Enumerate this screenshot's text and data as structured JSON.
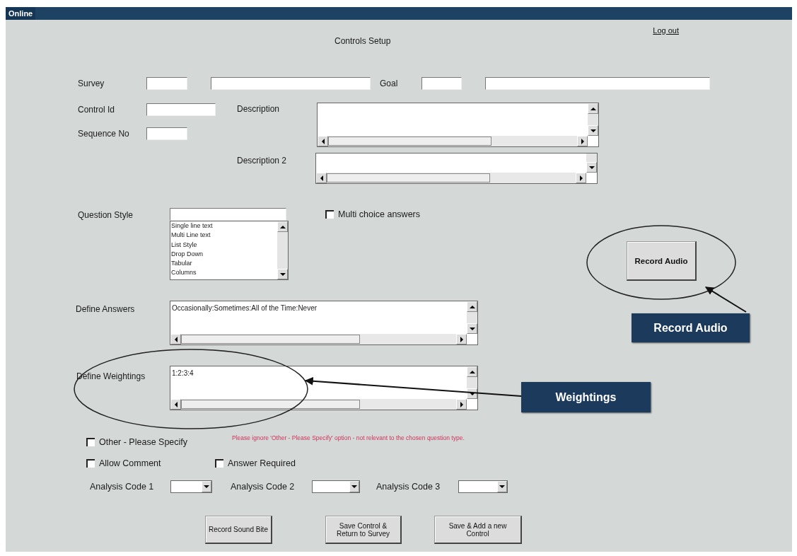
{
  "window": {
    "title": "Online"
  },
  "header": {
    "title": "Controls Setup",
    "logout": "Log out"
  },
  "survey": {
    "label": "Survey",
    "goal_label": "Goal"
  },
  "control_id": {
    "label": "Control Id"
  },
  "description": {
    "label": "Description"
  },
  "sequence_no": {
    "label": "Sequence No"
  },
  "description_2": {
    "label": "Description 2"
  },
  "question_style": {
    "label": "Question Style",
    "options": [
      "Single line text",
      "Multi Line text",
      "List Style",
      "Drop Down",
      "Tabular",
      "Columns"
    ]
  },
  "multi_choice": {
    "label": "Multi choice answers",
    "checked": false
  },
  "record_audio_button": "Record Audio",
  "define_answers": {
    "label": "Define Answers",
    "value": "Occasionally:Sometimes:All of the Time:Never"
  },
  "define_weightings": {
    "label": "Define Weightings",
    "value": "1:2:3:4"
  },
  "options": [
    {
      "label": "Other - Please Specify",
      "checked": false
    },
    {
      "label": "Allow Comment",
      "checked": false
    },
    {
      "label": "Answer Required",
      "checked": false
    }
  ],
  "note": "Please ignore 'Other - Please Specify' option - not relevant to the chosen question type.",
  "analysis_codes": [
    {
      "label": "Analysis Code 1"
    },
    {
      "label": "Analysis Code 2"
    },
    {
      "label": "Analysis Code 3"
    }
  ],
  "buttons": [
    "Record Sound Bite",
    "Save Control & Return to Survey",
    "Save & Add a new Control"
  ],
  "annotations": [
    {
      "kind": "callout",
      "text": "Record Audio"
    },
    {
      "kind": "callout",
      "text": "Weightings"
    }
  ]
}
